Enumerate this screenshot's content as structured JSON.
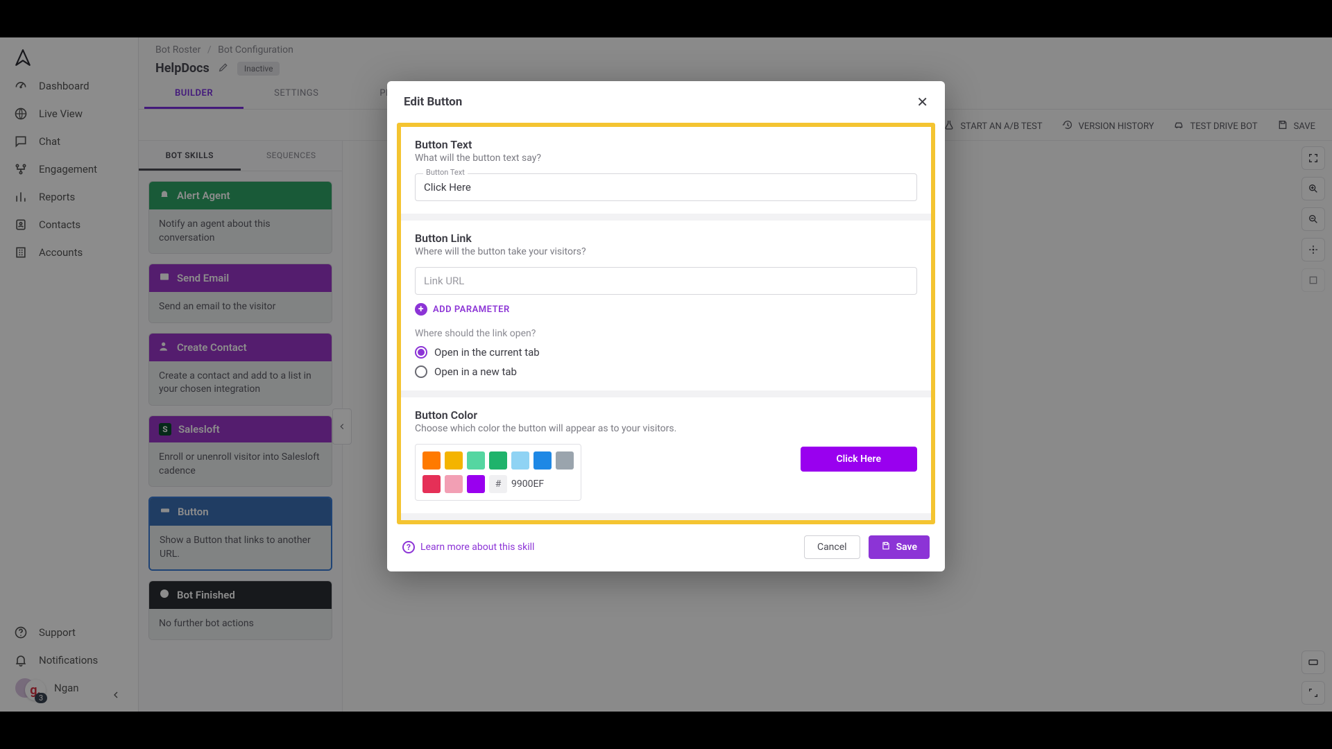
{
  "sidebar": {
    "items": [
      {
        "label": "Dashboard"
      },
      {
        "label": "Live View"
      },
      {
        "label": "Chat"
      },
      {
        "label": "Engagement"
      },
      {
        "label": "Reports"
      },
      {
        "label": "Contacts"
      },
      {
        "label": "Accounts"
      }
    ],
    "support": "Support",
    "notifications": "Notifications",
    "user_name": "Ngan",
    "user_badge": "g.",
    "user_count": "3"
  },
  "breadcrumb": {
    "root": "Bot Roster",
    "current": "Bot Configuration"
  },
  "page": {
    "title": "HelpDocs",
    "status": "Inactive"
  },
  "tabs": [
    "BUILDER",
    "SETTINGS",
    "PE"
  ],
  "toolbar": {
    "ab_test": "START AN A/B TEST",
    "version_history": "VERSION HISTORY",
    "test_drive": "TEST DRIVE BOT",
    "save": "SAVE"
  },
  "skills_tabs": [
    "BOT SKILLS",
    "SEQUENCES"
  ],
  "skills": [
    {
      "title": "Alert Agent",
      "desc": "Notify an agent about this conversation"
    },
    {
      "title": "Send Email",
      "desc": "Send an email to the visitor"
    },
    {
      "title": "Create Contact",
      "desc": "Create a contact and add to a list in your chosen integration"
    },
    {
      "title": "Salesloft",
      "desc": "Enroll or unenroll visitor into Salesloft cadence"
    },
    {
      "title": "Button",
      "desc": "Show a Button that links to another URL."
    },
    {
      "title": "Bot Finished",
      "desc": "No further bot actions"
    }
  ],
  "modal": {
    "title": "Edit Button",
    "section_text": {
      "title": "Button Text",
      "sub": "What will the button text say?",
      "field_label": "Button Text",
      "value": "Click Here"
    },
    "section_link": {
      "title": "Button Link",
      "sub": "Where will the button take your visitors?",
      "placeholder": "Link URL",
      "add_param": "ADD PARAMETER",
      "open_where": "Where should the link open?",
      "option_current": "Open in the current tab",
      "option_new": "Open in a new tab",
      "selected": "current"
    },
    "section_color": {
      "title": "Button Color",
      "sub": "Choose which color the button will appear as to your visitors.",
      "hex": "9900EF",
      "swatches_row1": [
        "#ff7a00",
        "#f4b400",
        "#55d6a1",
        "#1fb36b",
        "#8fd3f4",
        "#1e88e5",
        "#9aa4ad"
      ],
      "swatches_row2": [
        "#e53057",
        "#f29fb4",
        "#9900ef"
      ],
      "preview_label": "Click Here"
    },
    "footer": {
      "learn": "Learn more about this skill",
      "cancel": "Cancel",
      "save": "Save"
    }
  }
}
